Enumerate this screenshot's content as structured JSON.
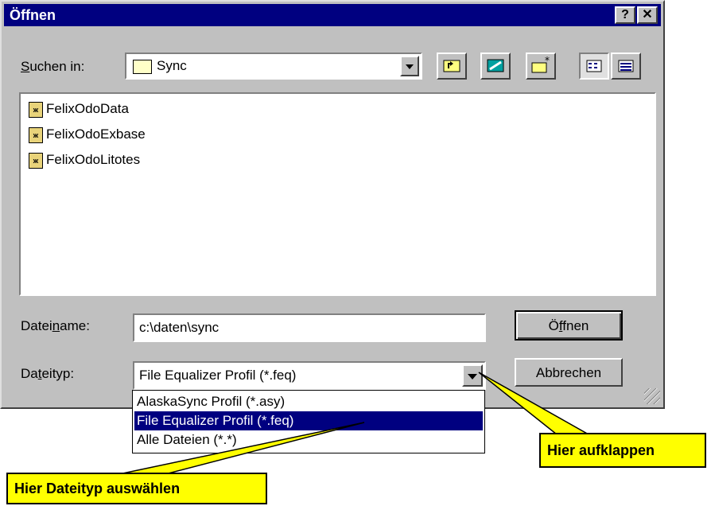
{
  "window": {
    "title": "Öffnen",
    "help_label": "?",
    "close_label": "✕"
  },
  "lookin": {
    "label_pre": "",
    "label_u": "S",
    "label_post": "uchen in:",
    "value": "Sync"
  },
  "toolbar": {
    "up_icon": "folder-up-icon",
    "desktop_icon": "desktop-icon",
    "newfolder_icon": "new-folder-icon",
    "list_icon": "list-view-icon",
    "details_icon": "details-view-icon"
  },
  "files": [
    {
      "name": "FelixOdoData"
    },
    {
      "name": "FelixOdoExbase"
    },
    {
      "name": "FelixOdoLitotes"
    }
  ],
  "filename": {
    "label_pre": "Datei",
    "label_u": "n",
    "label_post": "ame:",
    "value": "c:\\daten\\sync"
  },
  "filetype": {
    "label_pre": "Da",
    "label_u": "t",
    "label_post": "eityp:",
    "value": "File Equalizer Profil (*.feq)",
    "options": [
      "AlaskaSync Profil (*.asy)",
      "File Equalizer Profil (*.feq)",
      "Alle Dateien (*.*)"
    ],
    "selected_index": 1
  },
  "buttons": {
    "open_pre": "Ö",
    "open_u": "f",
    "open_post": "fnen",
    "cancel": "Abbrechen"
  },
  "callouts": {
    "expand": "Hier aufklappen",
    "choose": "Hier Dateityp auswählen"
  },
  "colors": {
    "titlebar": "#000080",
    "face": "#c0c0c0",
    "selection": "#000080",
    "callout": "#ffff00"
  }
}
